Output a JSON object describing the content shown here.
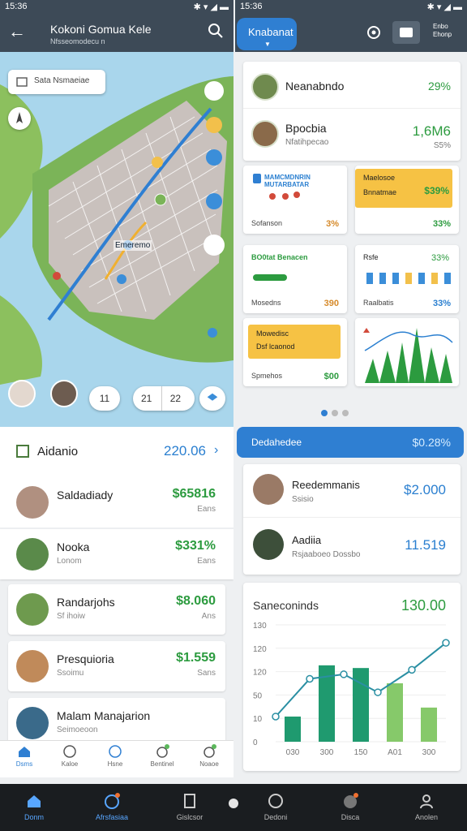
{
  "status": {
    "left_time": "15:36",
    "right_time": "15:36"
  },
  "left_header": {
    "title": "Kokoni Gomua Kele",
    "subtitle": "Nfsseomodecu n"
  },
  "right_header": {
    "pill_label": "Knabanat",
    "side_text": "Enbo\nEhonp"
  },
  "map": {
    "search_placeholder": "Sata Nsmaeiae",
    "area_label": "Emeremo",
    "chips": [
      "11",
      "21",
      "22"
    ],
    "chip_with_thumb": "21"
  },
  "left_summary": {
    "label": "Aidanio",
    "value": "220.06"
  },
  "left_items": [
    {
      "name": "Saldadiady",
      "sub": "",
      "amount": "$65816",
      "note": "Eans"
    },
    {
      "name": "Nooka",
      "sub": "Lonom",
      "amount": "$331%",
      "note": "Eans"
    },
    {
      "name": "Randarjohs",
      "sub": "Sf ihoiw",
      "amount": "$8.060",
      "note": "Ans"
    },
    {
      "name": "Presquioria",
      "sub": "Ssoimu",
      "amount": "$1.559",
      "note": "Sans"
    },
    {
      "name": "Malam Manajarion",
      "sub": "Seimoeoon",
      "amount": "",
      "note": ""
    }
  ],
  "left_tabs": [
    "Dsms",
    "Kaloe",
    "Hsne",
    "Bentinel",
    "Noaoe"
  ],
  "right_top": [
    {
      "name": "Neanabndo",
      "sub": "",
      "value": "29%",
      "sub_value": ""
    },
    {
      "name": "Bpocbia",
      "sub": "Nfatihpecao",
      "value": "1,6M6",
      "sub_value": "S5%"
    }
  ],
  "tiles": [
    {
      "title": "MAMCMDNRIN\nMUTARBATAR",
      "footer": "Sofanson",
      "footer_value": "3%"
    },
    {
      "title": "Maelosoe",
      "subtitle": "Bnnatmae",
      "value": "$39%",
      "footer": "",
      "footer_value": "33%"
    },
    {
      "title": "BO0tat Benacen",
      "footer": "Mosedns",
      "footer_value": "390"
    },
    {
      "title": "Rsfe",
      "value": "33%",
      "footer": "Raalbatis",
      "footer_value": "33%"
    },
    {
      "title": "Mowedisc",
      "subtitle": "Dsf lcaonod",
      "footer": "Spmehos",
      "footer_value": "$00"
    },
    {
      "title": "",
      "footer": "",
      "footer_value": ""
    }
  ],
  "banner": {
    "label": "Dedahedee",
    "value": "$0.28%"
  },
  "right_list": [
    {
      "name": "Reedemmanis",
      "sub": "Ssisio",
      "value": "$2.000"
    },
    {
      "name": "Aadiia",
      "sub": "Rsjaaboeo Dossbo",
      "value": "11.519"
    }
  ],
  "chart_data": {
    "type": "bar",
    "title": "Saneconinds",
    "total": "130.00",
    "y_ticks": [
      "130",
      "120",
      "120",
      "50",
      "10",
      "0"
    ],
    "categories": [
      "030",
      "300",
      "150",
      "A01",
      "300"
    ],
    "series": [
      {
        "values": [
          28,
          85,
          82,
          65,
          38
        ]
      }
    ],
    "line": [
      28,
      70,
      75,
      55,
      80,
      110
    ],
    "colors": {
      "bar_dark": "#1f9a6f",
      "bar_light": "#86c96a",
      "line": "#2a8fa3"
    }
  },
  "bottom_nav": [
    "Donm",
    "Afrsfasiaa",
    "Gislcsor",
    "Dedoni",
    "Disca",
    "Anolen"
  ],
  "colors": {
    "accent_blue": "#2f7fd2",
    "green": "#2c9b3f",
    "header": "#3d4a57"
  }
}
